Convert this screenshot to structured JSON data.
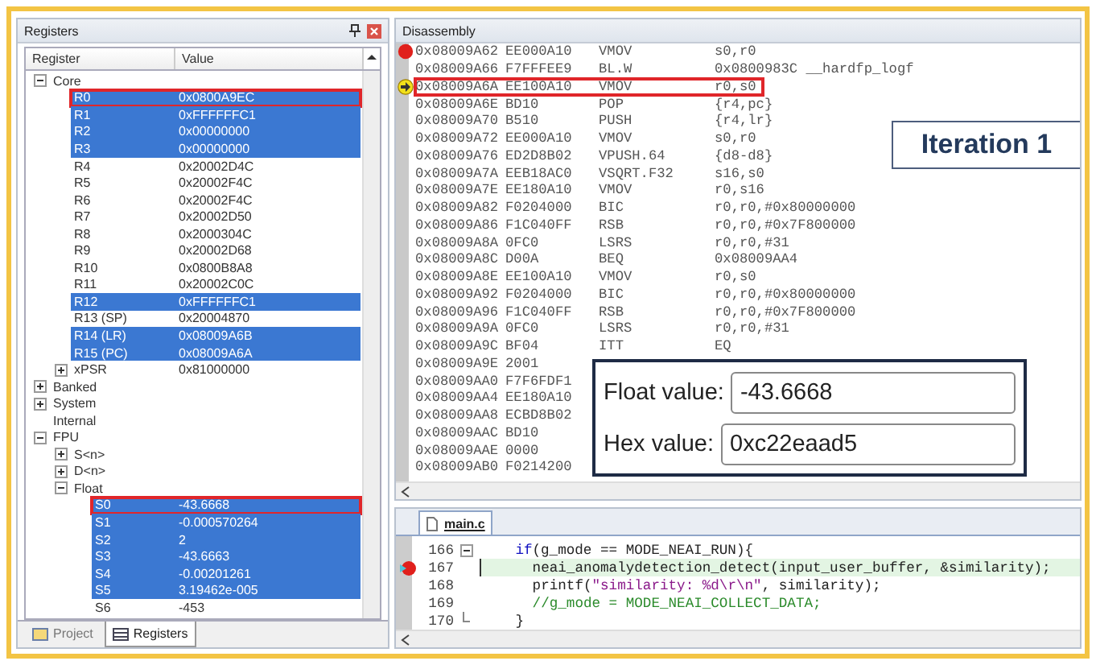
{
  "registers_panel": {
    "title": "Registers",
    "columns": [
      "Register",
      "Value"
    ],
    "tree": [
      {
        "name": "Core",
        "expanded": true,
        "selected": false,
        "outlined": false,
        "children": [
          {
            "name": "R0",
            "value": "0x0800A9EC",
            "selected": true,
            "outlined": true
          },
          {
            "name": "R1",
            "value": "0xFFFFFFC1",
            "selected": true,
            "outlined": false
          },
          {
            "name": "R2",
            "value": "0x00000000",
            "selected": true,
            "outlined": false
          },
          {
            "name": "R3",
            "value": "0x00000000",
            "selected": true,
            "outlined": false
          },
          {
            "name": "R4",
            "value": "0x20002D4C",
            "selected": false,
            "outlined": false
          },
          {
            "name": "R5",
            "value": "0x20002F4C",
            "selected": false,
            "outlined": false
          },
          {
            "name": "R6",
            "value": "0x20002F4C",
            "selected": false,
            "outlined": false
          },
          {
            "name": "R7",
            "value": "0x20002D50",
            "selected": false,
            "outlined": false
          },
          {
            "name": "R8",
            "value": "0x2000304C",
            "selected": false,
            "outlined": false
          },
          {
            "name": "R9",
            "value": "0x20002D68",
            "selected": false,
            "outlined": false
          },
          {
            "name": "R10",
            "value": "0x0800B8A8",
            "selected": false,
            "outlined": false
          },
          {
            "name": "R11",
            "value": "0x20002C0C",
            "selected": false,
            "outlined": false
          },
          {
            "name": "R12",
            "value": "0xFFFFFFC1",
            "selected": true,
            "outlined": false
          },
          {
            "name": "R13 (SP)",
            "value": "0x20004870",
            "selected": false,
            "outlined": false
          },
          {
            "name": "R14 (LR)",
            "value": "0x08009A6B",
            "selected": true,
            "outlined": false
          },
          {
            "name": "R15 (PC)",
            "value": "0x08009A6A",
            "selected": true,
            "outlined": false
          },
          {
            "name": "xPSR",
            "value": "0x81000000",
            "expanded": false,
            "selected": false,
            "outlined": false
          }
        ]
      },
      {
        "name": "Banked",
        "expanded": false,
        "selected": false,
        "outlined": false
      },
      {
        "name": "System",
        "expanded": false,
        "selected": false,
        "outlined": false
      },
      {
        "name": "Internal",
        "selected": false,
        "outlined": false
      },
      {
        "name": "FPU",
        "expanded": true,
        "selected": false,
        "outlined": false,
        "children": [
          {
            "name": "S<n>",
            "expanded": false,
            "selected": false,
            "outlined": false
          },
          {
            "name": "D<n>",
            "expanded": false,
            "selected": false,
            "outlined": false
          },
          {
            "name": "Float",
            "expanded": true,
            "selected": false,
            "outlined": false,
            "children": [
              {
                "name": "S0",
                "value": "-43.6668",
                "selected": true,
                "outlined": true
              },
              {
                "name": "S1",
                "value": "-0.000570264",
                "selected": true,
                "outlined": false
              },
              {
                "name": "S2",
                "value": "2",
                "selected": true,
                "outlined": false
              },
              {
                "name": "S3",
                "value": "-43.6663",
                "selected": true,
                "outlined": false
              },
              {
                "name": "S4",
                "value": "-0.00201261",
                "selected": true,
                "outlined": false
              },
              {
                "name": "S5",
                "value": "3.19462e-005",
                "selected": true,
                "outlined": false
              },
              {
                "name": "S6",
                "value": "-453",
                "selected": false,
                "outlined": false
              }
            ]
          }
        ]
      }
    ],
    "tabs": [
      {
        "label": "Project",
        "selected": false
      },
      {
        "label": "Registers",
        "selected": true
      }
    ]
  },
  "disassembly": {
    "title": "Disassembly",
    "rows": [
      {
        "address": "0x08009A62",
        "opcode": "EE000A10",
        "mnemonic": "VMOV",
        "operands": "s0,r0",
        "breakpoint": true,
        "current": false,
        "outlined": false
      },
      {
        "address": "0x08009A66",
        "opcode": "F7FFFEE9",
        "mnemonic": "BL.W",
        "operands": "0x0800983C __hardfp_logf",
        "breakpoint": false,
        "current": false,
        "outlined": false
      },
      {
        "address": "0x08009A6A",
        "opcode": "EE100A10",
        "mnemonic": "VMOV",
        "operands": "r0,s0",
        "breakpoint": false,
        "current": true,
        "outlined": true
      },
      {
        "address": "0x08009A6E",
        "opcode": "BD10",
        "mnemonic": "POP",
        "operands": "{r4,pc}",
        "breakpoint": false,
        "current": false,
        "outlined": false
      },
      {
        "address": "0x08009A70",
        "opcode": "B510",
        "mnemonic": "PUSH",
        "operands": "{r4,lr}",
        "breakpoint": false,
        "current": false,
        "outlined": false
      },
      {
        "address": "0x08009A72",
        "opcode": "EE000A10",
        "mnemonic": "VMOV",
        "operands": "s0,r0",
        "breakpoint": false,
        "current": false,
        "outlined": false
      },
      {
        "address": "0x08009A76",
        "opcode": "ED2D8B02",
        "mnemonic": "VPUSH.64",
        "operands": "{d8-d8}",
        "breakpoint": false,
        "current": false,
        "outlined": false
      },
      {
        "address": "0x08009A7A",
        "opcode": "EEB18AC0",
        "mnemonic": "VSQRT.F32",
        "operands": "s16,s0",
        "breakpoint": false,
        "current": false,
        "outlined": false
      },
      {
        "address": "0x08009A7E",
        "opcode": "EE180A10",
        "mnemonic": "VMOV",
        "operands": "r0,s16",
        "breakpoint": false,
        "current": false,
        "outlined": false
      },
      {
        "address": "0x08009A82",
        "opcode": "F0204000",
        "mnemonic": "BIC",
        "operands": "r0,r0,#0x80000000",
        "breakpoint": false,
        "current": false,
        "outlined": false
      },
      {
        "address": "0x08009A86",
        "opcode": "F1C040FF",
        "mnemonic": "RSB",
        "operands": "r0,r0,#0x7F800000",
        "breakpoint": false,
        "current": false,
        "outlined": false
      },
      {
        "address": "0x08009A8A",
        "opcode": "0FC0",
        "mnemonic": "LSRS",
        "operands": "r0,r0,#31",
        "breakpoint": false,
        "current": false,
        "outlined": false
      },
      {
        "address": "0x08009A8C",
        "opcode": "D00A",
        "mnemonic": "BEQ",
        "operands": "0x08009AA4",
        "breakpoint": false,
        "current": false,
        "outlined": false
      },
      {
        "address": "0x08009A8E",
        "opcode": "EE100A10",
        "mnemonic": "VMOV",
        "operands": "r0,s0",
        "breakpoint": false,
        "current": false,
        "outlined": false
      },
      {
        "address": "0x08009A92",
        "opcode": "F0204000",
        "mnemonic": "BIC",
        "operands": "r0,r0,#0x80000000",
        "breakpoint": false,
        "current": false,
        "outlined": false
      },
      {
        "address": "0x08009A96",
        "opcode": "F1C040FF",
        "mnemonic": "RSB",
        "operands": "r0,r0,#0x7F800000",
        "breakpoint": false,
        "current": false,
        "outlined": false
      },
      {
        "address": "0x08009A9A",
        "opcode": "0FC0",
        "mnemonic": "LSRS",
        "operands": "r0,r0,#31",
        "breakpoint": false,
        "current": false,
        "outlined": false
      },
      {
        "address": "0x08009A9C",
        "opcode": "BF04",
        "mnemonic": "ITT",
        "operands": "EQ",
        "breakpoint": false,
        "current": false,
        "outlined": false
      },
      {
        "address": "0x08009A9E",
        "opcode": "2001",
        "breakpoint": false,
        "current": false,
        "outlined": false
      },
      {
        "address": "0x08009AA0",
        "opcode": "F7F6FDF1",
        "breakpoint": false,
        "current": false,
        "outlined": false
      },
      {
        "address": "0x08009AA4",
        "opcode": "EE180A10",
        "breakpoint": false,
        "current": false,
        "outlined": false
      },
      {
        "address": "0x08009AA8",
        "opcode": "ECBD8B02",
        "breakpoint": false,
        "current": false,
        "outlined": false
      },
      {
        "address": "0x08009AAC",
        "opcode": "BD10",
        "breakpoint": false,
        "current": false,
        "outlined": false
      },
      {
        "address": "0x08009AAE",
        "opcode": "0000",
        "breakpoint": false,
        "current": false,
        "outlined": false
      },
      {
        "address": "0x08009AB0",
        "opcode": "F0214200",
        "breakpoint": false,
        "current": false,
        "outlined": false
      }
    ]
  },
  "iteration_label": "Iteration 1",
  "converter": {
    "float_label": "Float value:",
    "float_value": "-43.6668",
    "hex_label": "Hex value:",
    "hex_value": "0xc22eaad5"
  },
  "editor": {
    "tabs": [
      {
        "label": "main.c",
        "selected": true
      }
    ],
    "lines": [
      {
        "number": "166",
        "expanded": true,
        "breakpoint": false,
        "current": false,
        "segments": [
          {
            "kind": "keyword",
            "text": "if"
          },
          {
            "kind": "plain",
            "text": "(g_mode == MODE_NEAI_RUN){"
          }
        ],
        "children": [
          {
            "number": "167",
            "breakpoint": true,
            "current": true,
            "segments": [
              {
                "kind": "plain",
                "text": "neai_anomalydetection_detect(input_user_buffer, &similarity);"
              }
            ]
          },
          {
            "number": "168",
            "breakpoint": false,
            "current": false,
            "segments": [
              {
                "kind": "plain",
                "text": "printf("
              },
              {
                "kind": "string",
                "text": "\"similarity: %d\\r\\n\""
              },
              {
                "kind": "plain",
                "text": ", similarity);"
              }
            ]
          },
          {
            "number": "169",
            "breakpoint": false,
            "current": false,
            "segments": [
              {
                "kind": "comment",
                "text": "//g_mode = MODE_NEAI_COLLECT_DATA;"
              }
            ]
          }
        ]
      },
      {
        "number": "170",
        "breakpoint": false,
        "current": false,
        "segments": [
          {
            "kind": "plain",
            "text": "}"
          }
        ]
      }
    ]
  }
}
